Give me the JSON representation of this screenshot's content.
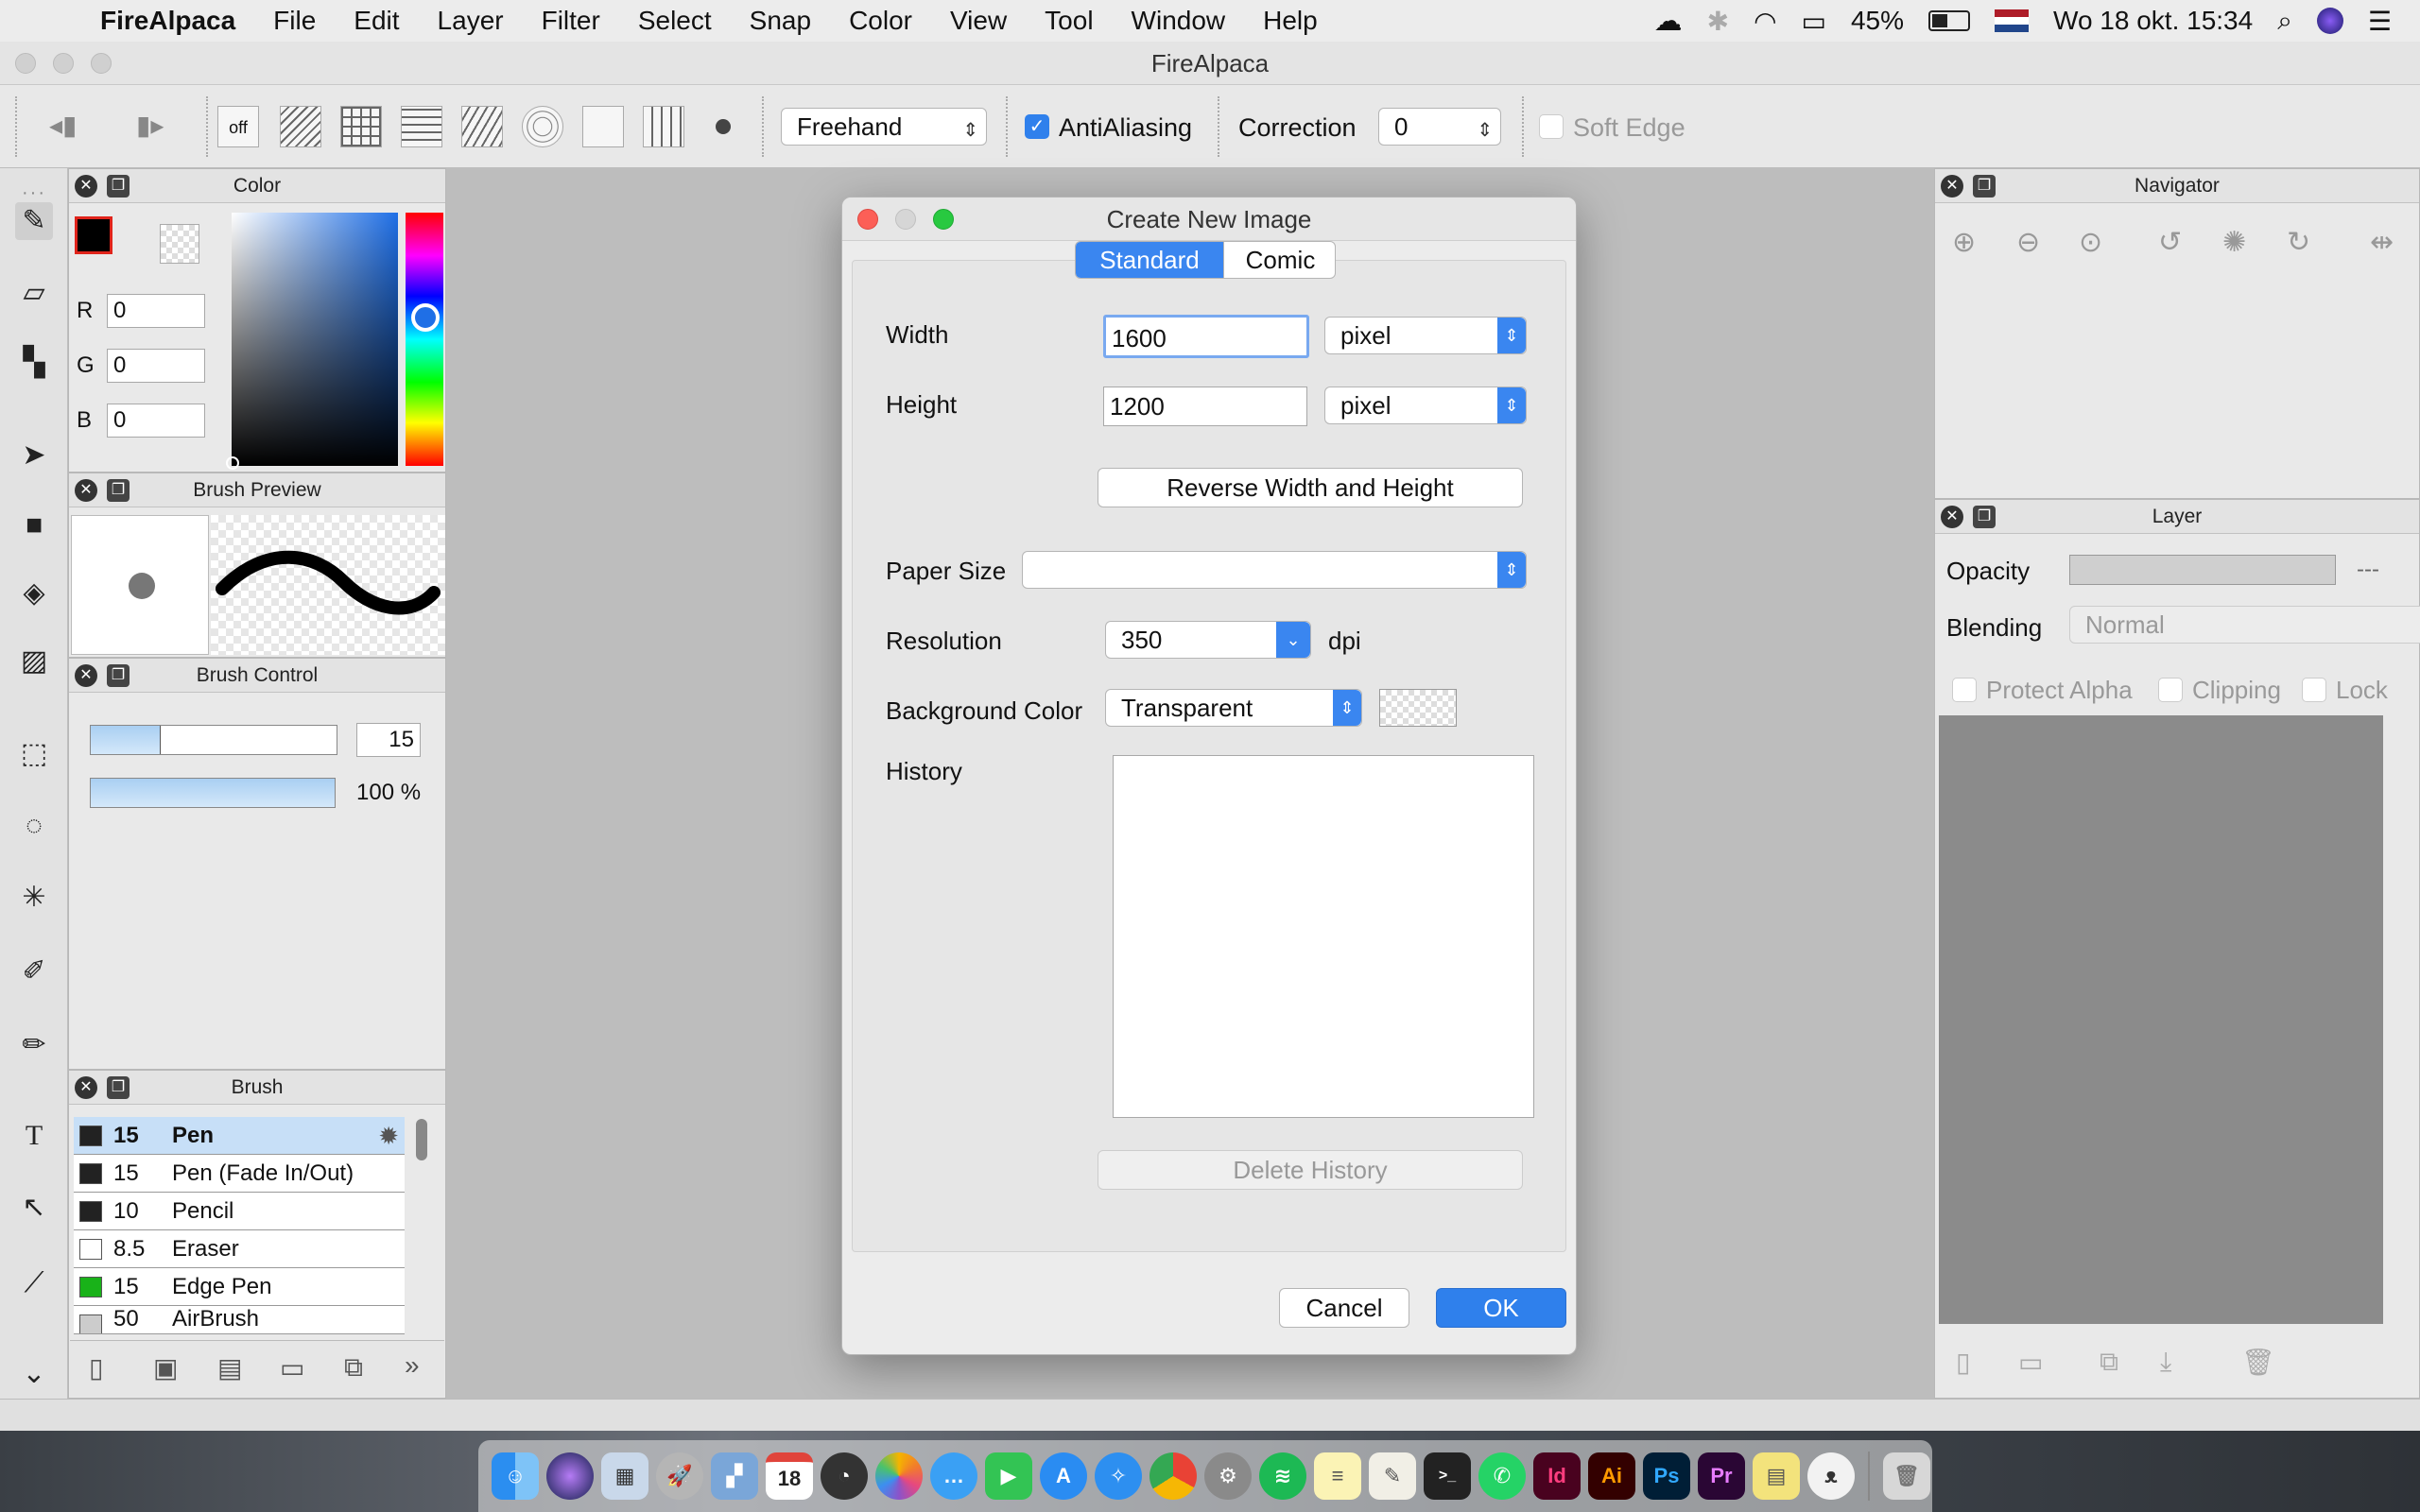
{
  "menubar": {
    "app": "FireAlpaca",
    "items": [
      "File",
      "Edit",
      "Layer",
      "Filter",
      "Select",
      "Snap",
      "Color",
      "View",
      "Tool",
      "Window",
      "Help"
    ],
    "battery": "45%",
    "clock": "Wo 18 okt. 15:34"
  },
  "window": {
    "title": "FireAlpaca"
  },
  "toolbar": {
    "snap_off_label": "off",
    "mode": "Freehand",
    "antialiasing_label": "AntiAliasing",
    "antialiasing_checked": true,
    "correction_label": "Correction",
    "correction_value": "0",
    "soft_edge_label": "Soft Edge"
  },
  "color_panel": {
    "title": "Color",
    "r_label": "R",
    "r": "0",
    "g_label": "G",
    "g": "0",
    "b_label": "B",
    "b": "0",
    "primary_color": "#000000"
  },
  "brush_preview": {
    "title": "Brush Preview"
  },
  "brush_control": {
    "title": "Brush Control",
    "size": "15",
    "opacity": "100 %"
  },
  "brush": {
    "title": "Brush",
    "items": [
      {
        "size": "15",
        "name": "Pen",
        "color": "#222222"
      },
      {
        "size": "15",
        "name": "Pen (Fade In/Out)",
        "color": "#222222"
      },
      {
        "size": "10",
        "name": "Pencil",
        "color": "#222222"
      },
      {
        "size": "8.5",
        "name": "Eraser",
        "color": "#ffffff"
      },
      {
        "size": "15",
        "name": "Edge Pen",
        "color": "#19b219"
      },
      {
        "size": "50",
        "name": "AirBrush",
        "color": "#cccccc"
      }
    ]
  },
  "dialog": {
    "title": "Create New Image",
    "tabs": [
      "Standard",
      "Comic"
    ],
    "width_label": "Width",
    "width": "1600",
    "width_unit": "pixel",
    "height_label": "Height",
    "height": "1200",
    "height_unit": "pixel",
    "reverse_label": "Reverse Width and Height",
    "paper_size_label": "Paper Size",
    "paper_size": "",
    "resolution_label": "Resolution",
    "resolution": "350",
    "resolution_unit": "dpi",
    "bg_label": "Background Color",
    "bg": "Transparent",
    "history_label": "History",
    "delete_history_label": "Delete History",
    "cancel_label": "Cancel",
    "ok_label": "OK"
  },
  "navigator": {
    "title": "Navigator"
  },
  "layer": {
    "title": "Layer",
    "opacity_label": "Opacity",
    "opacity_value": "---",
    "blending_label": "Blending",
    "blending": "Normal",
    "protect_alpha_label": "Protect Alpha",
    "clipping_label": "Clipping",
    "lock_label": "Lock"
  },
  "dock": {
    "calendar_day": "18",
    "apps": [
      "Id",
      "Ai",
      "Ps",
      "Pr"
    ]
  }
}
